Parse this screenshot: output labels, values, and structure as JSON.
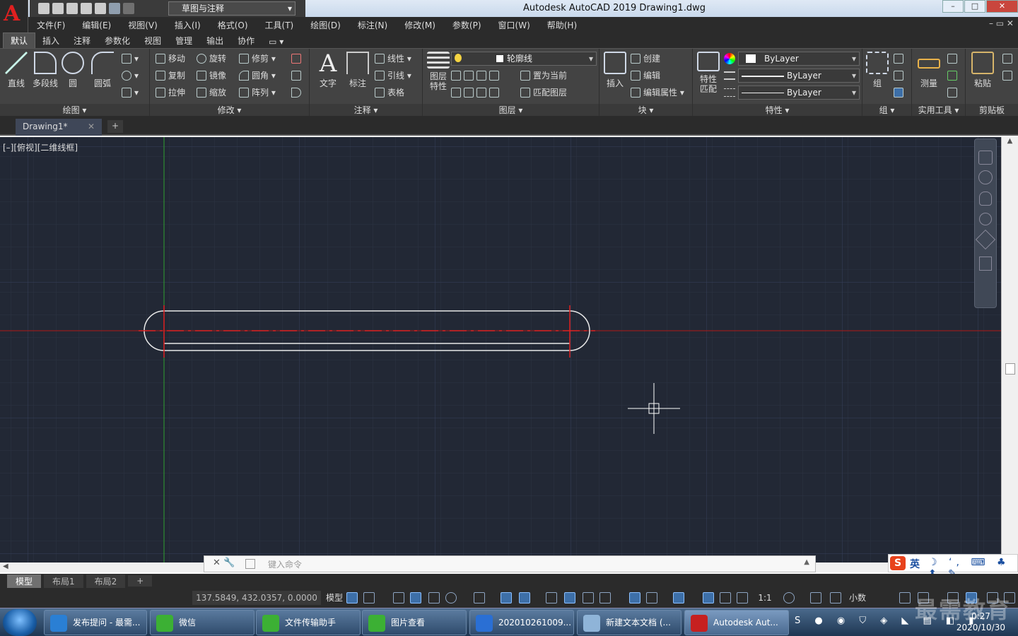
{
  "app": {
    "title": "Autodesk AutoCAD 2019    Drawing1.dwg",
    "workspace": "草图与注释",
    "window_controls": [
      "–",
      "□",
      "✕"
    ]
  },
  "menu": [
    "文件(F)",
    "编辑(E)",
    "视图(V)",
    "插入(I)",
    "格式(O)",
    "工具(T)",
    "绘图(D)",
    "标注(N)",
    "修改(M)",
    "参数(P)",
    "窗口(W)",
    "帮助(H)"
  ],
  "ribbon_tabs": [
    "默认",
    "插入",
    "注释",
    "参数化",
    "视图",
    "管理",
    "输出",
    "协作"
  ],
  "panels": {
    "draw": {
      "title": "绘图 ▾",
      "line": "直线",
      "polyline": "多段线",
      "circle": "圆",
      "arc": "圆弧"
    },
    "modify": {
      "title": "修改 ▾",
      "move": "移动",
      "rotate": "旋转",
      "trim": "修剪",
      "copy": "复制",
      "mirror": "镜像",
      "fillet": "圆角",
      "stretch": "拉伸",
      "scale": "缩放",
      "array": "阵列"
    },
    "annotation": {
      "title": "注释 ▾",
      "text": "文字",
      "dimension": "标注",
      "linear": "线性",
      "leader": "引线",
      "table": "表格"
    },
    "layers": {
      "title": "图层 ▾",
      "layer_props": "图层\n特性",
      "current_layer": "轮廓线",
      "set_current": "置为当前",
      "match_layer": "匹配图层"
    },
    "block": {
      "title": "块 ▾",
      "insert": "插入",
      "create": "创建",
      "edit": "编辑",
      "edit_attr": "编辑属性"
    },
    "properties": {
      "title": "特性 ▾",
      "match": "特性\n匹配",
      "color": "ByLayer",
      "linetype": "ByLayer",
      "lineweight": "ByLayer"
    },
    "groups": {
      "title": "组 ▾",
      "group": "组"
    },
    "utilities": {
      "title": "实用工具 ▾",
      "measure": "测量"
    },
    "clipboard": {
      "title": "剪贴板",
      "paste": "粘贴"
    }
  },
  "document_tab": "Drawing1*",
  "viewport_label": "[–][俯视][二维线框]",
  "command_placeholder": "键入命令",
  "layout_tabs": [
    "模型",
    "布局1",
    "布局2"
  ],
  "status": {
    "coords": "137.5849, 432.0357, 0.0000",
    "model": "模型",
    "scale": "1:1",
    "units": "小数"
  },
  "ime": {
    "lang": "英"
  },
  "taskbar": [
    {
      "label": "发布提问 - 最需...",
      "color": "#2a7fd4"
    },
    {
      "label": "微信",
      "color": "#3cb034"
    },
    {
      "label": "文件传输助手",
      "color": "#3cb034"
    },
    {
      "label": "图片查看",
      "color": "#3cb034"
    },
    {
      "label": "202010261009...",
      "color": "#2a6fd4"
    },
    {
      "label": "新建文本文档 (...",
      "color": "#8fb4d8"
    },
    {
      "label": "Autodesk Aut...",
      "color": "#c62020"
    }
  ],
  "clock": {
    "time": "0:27",
    "date": "2020/10/30"
  },
  "watermark": "最需教育",
  "colors": {
    "canvas": "#222835",
    "centerline": "#e02020",
    "outline": "#ffffff",
    "ucs_green": "#2fa02f"
  }
}
